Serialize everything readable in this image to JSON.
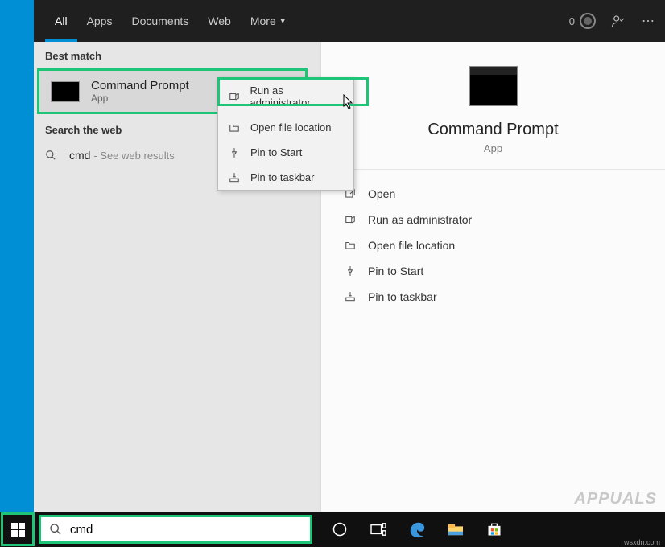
{
  "header": {
    "tabs": [
      "All",
      "Apps",
      "Documents",
      "Web",
      "More"
    ],
    "rewards": "0"
  },
  "left": {
    "best_match_label": "Best match",
    "match": {
      "title": "Command Prompt",
      "subtitle": "App"
    },
    "web_label": "Search the web",
    "web": {
      "query": "cmd",
      "hint": "- See web results"
    }
  },
  "context": {
    "items": [
      {
        "icon": "admin",
        "label": "Run as administrator"
      },
      {
        "icon": "folder",
        "label": "Open file location"
      },
      {
        "icon": "pin",
        "label": "Pin to Start"
      },
      {
        "icon": "taskbar",
        "label": "Pin to taskbar"
      }
    ]
  },
  "preview": {
    "title": "Command Prompt",
    "subtitle": "App",
    "actions": [
      {
        "icon": "open",
        "label": "Open"
      },
      {
        "icon": "admin",
        "label": "Run as administrator"
      },
      {
        "icon": "folder",
        "label": "Open file location"
      },
      {
        "icon": "pin",
        "label": "Pin to Start"
      },
      {
        "icon": "taskbar",
        "label": "Pin to taskbar"
      }
    ]
  },
  "search": {
    "value": "cmd"
  },
  "watermark": "APPUALS",
  "attribution": "wsxdn.com"
}
